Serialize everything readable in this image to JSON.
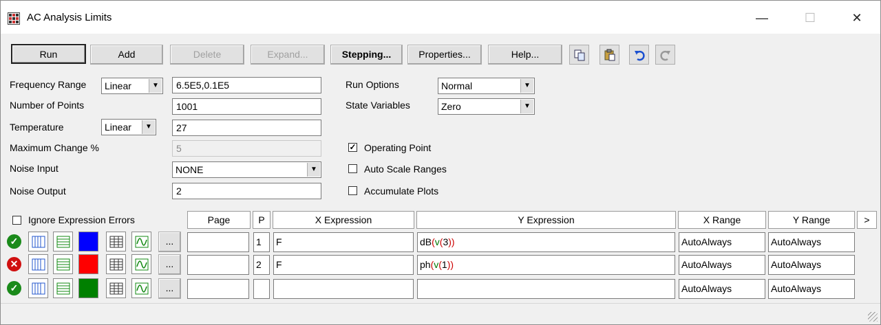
{
  "window": {
    "title": "AC Analysis Limits",
    "controls": {
      "minimize": "—",
      "maximize": "☐",
      "close": "✕"
    }
  },
  "toolbar": {
    "run": "Run",
    "add": "Add",
    "delete": "Delete",
    "expand": "Expand...",
    "stepping": "Stepping...",
    "properties": "Properties...",
    "help": "Help...",
    "icons": [
      "copy-icon",
      "paste-icon",
      "undo-icon",
      "redo-icon"
    ]
  },
  "fields": {
    "frequency_range": {
      "label": "Frequency Range",
      "mode": "Linear",
      "value": "6.5E5,0.1E5"
    },
    "number_of_points": {
      "label": "Number of Points",
      "value": "1001"
    },
    "temperature": {
      "label": "Temperature",
      "mode": "Linear",
      "value": "27"
    },
    "maximum_change": {
      "label": "Maximum Change %",
      "value": "5"
    },
    "noise_input": {
      "label": "Noise Input",
      "value": "NONE"
    },
    "noise_output": {
      "label": "Noise Output",
      "value": "2"
    },
    "run_options": {
      "label": "Run Options",
      "value": "Normal"
    },
    "state_variables": {
      "label": "State Variables",
      "value": "Zero"
    }
  },
  "options": {
    "operating_point": {
      "label": "Operating Point",
      "checked": true
    },
    "auto_scale_ranges": {
      "label": "Auto Scale Ranges",
      "checked": false
    },
    "accumulate_plots": {
      "label": "Accumulate Plots",
      "checked": false
    },
    "ignore_expression_errors": {
      "label": "Ignore Expression Errors",
      "checked": false
    }
  },
  "table": {
    "headers": {
      "page": "Page",
      "p": "P",
      "x_expression": "X Expression",
      "y_expression": "Y Expression",
      "x_range": "X Range",
      "y_range": "Y Range",
      "more": ">"
    },
    "more_button": "...",
    "rows": [
      {
        "enabled": true,
        "color": "#0000ff",
        "page": "",
        "p": "1",
        "x": "F",
        "y_fn": "dB",
        "y_var": "v",
        "y_node": "3",
        "x_range": "AutoAlways",
        "y_range": "AutoAlways"
      },
      {
        "enabled": false,
        "color": "#ff0000",
        "page": "",
        "p": "2",
        "x": "F",
        "y_fn": "ph",
        "y_var": "v",
        "y_node": "1",
        "x_range": "AutoAlways",
        "y_range": "AutoAlways"
      },
      {
        "enabled": true,
        "color": "#008000",
        "page": "",
        "p": "",
        "x": "",
        "y_fn": "",
        "y_var": "",
        "y_node": "",
        "x_range": "AutoAlways",
        "y_range": "AutoAlways"
      }
    ]
  },
  "colors": {
    "enabled": "#1a8a1a",
    "disabled": "#d01010"
  }
}
